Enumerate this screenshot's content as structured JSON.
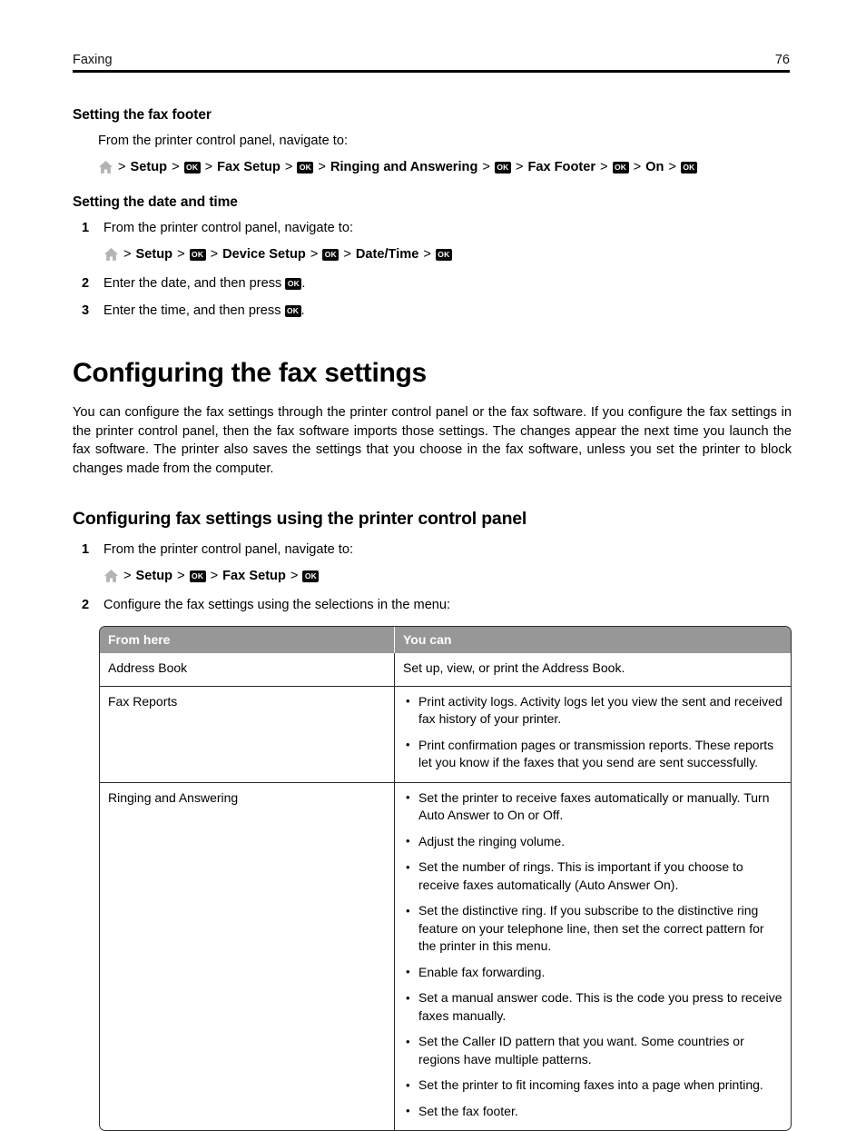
{
  "header": {
    "chapter": "Faxing",
    "page_number": "76"
  },
  "icons": {
    "home": "home-icon",
    "ok": "OK"
  },
  "sections": [
    {
      "id": "fax-footer",
      "heading": "Setting the fax footer",
      "lead": "From the printer control panel, navigate to:",
      "path": [
        "Setup",
        "Fax Setup",
        "Ringing and Answering",
        "Fax Footer",
        "On"
      ]
    },
    {
      "id": "date-time",
      "heading": "Setting the date and time",
      "steps": [
        {
          "num": "1",
          "text": "From the printer control panel, navigate to:"
        },
        {
          "num": "2",
          "text_before": "Enter the date, and then press",
          "text_after": "."
        },
        {
          "num": "3",
          "text_before": "Enter the time, and then press",
          "text_after": "."
        }
      ],
      "path": [
        "Setup",
        "Device Setup",
        "Date/Time"
      ]
    }
  ],
  "main_section": {
    "title": "Configuring the fax settings",
    "body": "You can configure the fax settings through the printer control panel or the fax software. If you configure the fax settings in the printer control panel, then the fax software imports those settings. The changes appear the next time you launch the fax software. The printer also saves the settings that you choose in the fax software, unless you set the printer to block changes made from the computer."
  },
  "subsection": {
    "title": "Configuring fax settings using the printer control panel",
    "steps": [
      {
        "num": "1",
        "text": "From the printer control panel, navigate to:"
      },
      {
        "num": "2",
        "text": "Configure the fax settings using the selections in the menu:"
      }
    ],
    "path": [
      "Setup",
      "Fax Setup"
    ]
  },
  "table": {
    "columns": [
      "From here",
      "You can"
    ],
    "rows": [
      {
        "from_here": "Address Book",
        "you_can_text": "Set up, view, or print the Address Book.",
        "you_can_bullets": []
      },
      {
        "from_here": "Fax Reports",
        "you_can_text": "",
        "you_can_bullets": [
          "Print activity logs. Activity logs let you view the sent and received fax history of your printer.",
          "Print confirmation pages or transmission reports. These reports let you know if the faxes that you send are sent successfully."
        ]
      },
      {
        "from_here": "Ringing and Answering",
        "you_can_text": "",
        "you_can_bullets": [
          "Set the printer to receive faxes automatically or manually. Turn Auto Answer to On or Off.",
          "Adjust the ringing volume.",
          "Set the number of rings. This is important if you choose to receive faxes automatically (Auto Answer On).",
          "Set the distinctive ring. If you subscribe to the distinctive ring feature on your telephone line, then set the correct pattern for the printer in this menu.",
          "Enable fax forwarding.",
          "Set a manual answer code. This is the code you press to receive faxes manually.",
          "Set the Caller ID pattern that you want. Some countries or regions have multiple patterns.",
          "Set the printer to fit incoming faxes into a page when printing.",
          "Set the fax footer."
        ]
      }
    ]
  },
  "colors": {
    "table_header_bg": "#979797",
    "table_border": "#2b2b2b",
    "ok_badge_bg": "#0a0a0a",
    "home_icon": "#b4b4b4",
    "rule": "#000000"
  }
}
